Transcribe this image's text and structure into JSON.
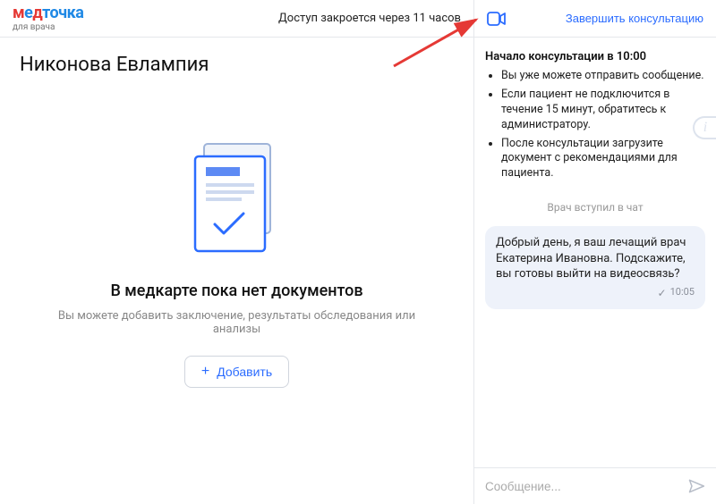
{
  "logo": {
    "prefix_m": "м",
    "prefix_e": "е",
    "prefix_d": "д",
    "rest": "точка",
    "subtitle": "для врача"
  },
  "header": {
    "access": "Доступ закроется через 11 часов",
    "end_button": "Завершить консультацию"
  },
  "patient": {
    "name": "Никонова Евлампия"
  },
  "empty": {
    "title": "В медкарте пока нет документов",
    "subtitle": "Вы можете добавить заключение, результаты обследования или анализы",
    "add_label": "Добавить"
  },
  "chat": {
    "start_title": "Начало консультации в 10:00",
    "bullets": [
      "Вы уже можете отправить сообщение.",
      "Если пациент не подключится в течение 15 минут, обратитесь к администратору.",
      "После консультации загрузите документ с рекомендациями для пациента."
    ],
    "system_line": "Врач вступил в чат",
    "message": {
      "text": "Добрый день, я ваш лечащий врач Екатерина Ивановна. Подскажите, вы готовы выйти на видеосвязь?",
      "time": "10:05"
    },
    "input_placeholder": "Сообщение..."
  }
}
